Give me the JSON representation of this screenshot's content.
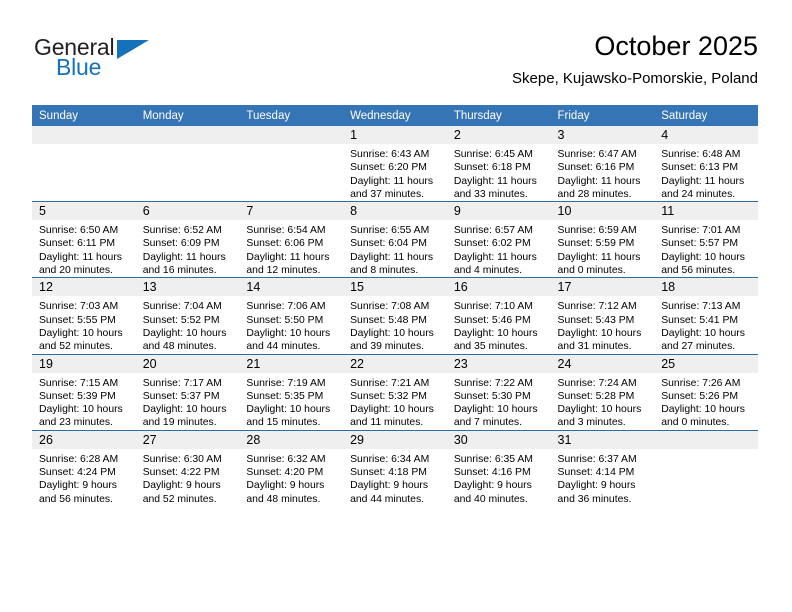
{
  "brand": {
    "name_part1": "General",
    "name_part2": "Blue",
    "color_primary": "#1671bb",
    "color_text": "#231f20",
    "triangle_icon": "triangle-icon"
  },
  "header": {
    "title": "October 2025",
    "subtitle": "Skepe, Kujawsko-Pomorskie, Poland"
  },
  "calendar": {
    "header_bg": "#3574b5",
    "daynum_bg": "#efefef",
    "row_divider": "#2e6da4",
    "weekday_headers": [
      "Sunday",
      "Monday",
      "Tuesday",
      "Wednesday",
      "Thursday",
      "Friday",
      "Saturday"
    ],
    "weeks": [
      [
        {
          "day": "",
          "blank": true
        },
        {
          "day": "",
          "blank": true
        },
        {
          "day": "",
          "blank": true
        },
        {
          "day": "1",
          "sunrise": "Sunrise: 6:43 AM",
          "sunset": "Sunset: 6:20 PM",
          "daylight_line1": "Daylight: 11 hours",
          "daylight_line2": "and 37 minutes."
        },
        {
          "day": "2",
          "sunrise": "Sunrise: 6:45 AM",
          "sunset": "Sunset: 6:18 PM",
          "daylight_line1": "Daylight: 11 hours",
          "daylight_line2": "and 33 minutes."
        },
        {
          "day": "3",
          "sunrise": "Sunrise: 6:47 AM",
          "sunset": "Sunset: 6:16 PM",
          "daylight_line1": "Daylight: 11 hours",
          "daylight_line2": "and 28 minutes."
        },
        {
          "day": "4",
          "sunrise": "Sunrise: 6:48 AM",
          "sunset": "Sunset: 6:13 PM",
          "daylight_line1": "Daylight: 11 hours",
          "daylight_line2": "and 24 minutes."
        }
      ],
      [
        {
          "day": "5",
          "sunrise": "Sunrise: 6:50 AM",
          "sunset": "Sunset: 6:11 PM",
          "daylight_line1": "Daylight: 11 hours",
          "daylight_line2": "and 20 minutes."
        },
        {
          "day": "6",
          "sunrise": "Sunrise: 6:52 AM",
          "sunset": "Sunset: 6:09 PM",
          "daylight_line1": "Daylight: 11 hours",
          "daylight_line2": "and 16 minutes."
        },
        {
          "day": "7",
          "sunrise": "Sunrise: 6:54 AM",
          "sunset": "Sunset: 6:06 PM",
          "daylight_line1": "Daylight: 11 hours",
          "daylight_line2": "and 12 minutes."
        },
        {
          "day": "8",
          "sunrise": "Sunrise: 6:55 AM",
          "sunset": "Sunset: 6:04 PM",
          "daylight_line1": "Daylight: 11 hours",
          "daylight_line2": "and 8 minutes."
        },
        {
          "day": "9",
          "sunrise": "Sunrise: 6:57 AM",
          "sunset": "Sunset: 6:02 PM",
          "daylight_line1": "Daylight: 11 hours",
          "daylight_line2": "and 4 minutes."
        },
        {
          "day": "10",
          "sunrise": "Sunrise: 6:59 AM",
          "sunset": "Sunset: 5:59 PM",
          "daylight_line1": "Daylight: 11 hours",
          "daylight_line2": "and 0 minutes."
        },
        {
          "day": "11",
          "sunrise": "Sunrise: 7:01 AM",
          "sunset": "Sunset: 5:57 PM",
          "daylight_line1": "Daylight: 10 hours",
          "daylight_line2": "and 56 minutes."
        }
      ],
      [
        {
          "day": "12",
          "sunrise": "Sunrise: 7:03 AM",
          "sunset": "Sunset: 5:55 PM",
          "daylight_line1": "Daylight: 10 hours",
          "daylight_line2": "and 52 minutes."
        },
        {
          "day": "13",
          "sunrise": "Sunrise: 7:04 AM",
          "sunset": "Sunset: 5:52 PM",
          "daylight_line1": "Daylight: 10 hours",
          "daylight_line2": "and 48 minutes."
        },
        {
          "day": "14",
          "sunrise": "Sunrise: 7:06 AM",
          "sunset": "Sunset: 5:50 PM",
          "daylight_line1": "Daylight: 10 hours",
          "daylight_line2": "and 44 minutes."
        },
        {
          "day": "15",
          "sunrise": "Sunrise: 7:08 AM",
          "sunset": "Sunset: 5:48 PM",
          "daylight_line1": "Daylight: 10 hours",
          "daylight_line2": "and 39 minutes."
        },
        {
          "day": "16",
          "sunrise": "Sunrise: 7:10 AM",
          "sunset": "Sunset: 5:46 PM",
          "daylight_line1": "Daylight: 10 hours",
          "daylight_line2": "and 35 minutes."
        },
        {
          "day": "17",
          "sunrise": "Sunrise: 7:12 AM",
          "sunset": "Sunset: 5:43 PM",
          "daylight_line1": "Daylight: 10 hours",
          "daylight_line2": "and 31 minutes."
        },
        {
          "day": "18",
          "sunrise": "Sunrise: 7:13 AM",
          "sunset": "Sunset: 5:41 PM",
          "daylight_line1": "Daylight: 10 hours",
          "daylight_line2": "and 27 minutes."
        }
      ],
      [
        {
          "day": "19",
          "sunrise": "Sunrise: 7:15 AM",
          "sunset": "Sunset: 5:39 PM",
          "daylight_line1": "Daylight: 10 hours",
          "daylight_line2": "and 23 minutes."
        },
        {
          "day": "20",
          "sunrise": "Sunrise: 7:17 AM",
          "sunset": "Sunset: 5:37 PM",
          "daylight_line1": "Daylight: 10 hours",
          "daylight_line2": "and 19 minutes."
        },
        {
          "day": "21",
          "sunrise": "Sunrise: 7:19 AM",
          "sunset": "Sunset: 5:35 PM",
          "daylight_line1": "Daylight: 10 hours",
          "daylight_line2": "and 15 minutes."
        },
        {
          "day": "22",
          "sunrise": "Sunrise: 7:21 AM",
          "sunset": "Sunset: 5:32 PM",
          "daylight_line1": "Daylight: 10 hours",
          "daylight_line2": "and 11 minutes."
        },
        {
          "day": "23",
          "sunrise": "Sunrise: 7:22 AM",
          "sunset": "Sunset: 5:30 PM",
          "daylight_line1": "Daylight: 10 hours",
          "daylight_line2": "and 7 minutes."
        },
        {
          "day": "24",
          "sunrise": "Sunrise: 7:24 AM",
          "sunset": "Sunset: 5:28 PM",
          "daylight_line1": "Daylight: 10 hours",
          "daylight_line2": "and 3 minutes."
        },
        {
          "day": "25",
          "sunrise": "Sunrise: 7:26 AM",
          "sunset": "Sunset: 5:26 PM",
          "daylight_line1": "Daylight: 10 hours",
          "daylight_line2": "and 0 minutes."
        }
      ],
      [
        {
          "day": "26",
          "sunrise": "Sunrise: 6:28 AM",
          "sunset": "Sunset: 4:24 PM",
          "daylight_line1": "Daylight: 9 hours",
          "daylight_line2": "and 56 minutes."
        },
        {
          "day": "27",
          "sunrise": "Sunrise: 6:30 AM",
          "sunset": "Sunset: 4:22 PM",
          "daylight_line1": "Daylight: 9 hours",
          "daylight_line2": "and 52 minutes."
        },
        {
          "day": "28",
          "sunrise": "Sunrise: 6:32 AM",
          "sunset": "Sunset: 4:20 PM",
          "daylight_line1": "Daylight: 9 hours",
          "daylight_line2": "and 48 minutes."
        },
        {
          "day": "29",
          "sunrise": "Sunrise: 6:34 AM",
          "sunset": "Sunset: 4:18 PM",
          "daylight_line1": "Daylight: 9 hours",
          "daylight_line2": "and 44 minutes."
        },
        {
          "day": "30",
          "sunrise": "Sunrise: 6:35 AM",
          "sunset": "Sunset: 4:16 PM",
          "daylight_line1": "Daylight: 9 hours",
          "daylight_line2": "and 40 minutes."
        },
        {
          "day": "31",
          "sunrise": "Sunrise: 6:37 AM",
          "sunset": "Sunset: 4:14 PM",
          "daylight_line1": "Daylight: 9 hours",
          "daylight_line2": "and 36 minutes."
        },
        {
          "day": "",
          "blank": true
        }
      ]
    ]
  }
}
